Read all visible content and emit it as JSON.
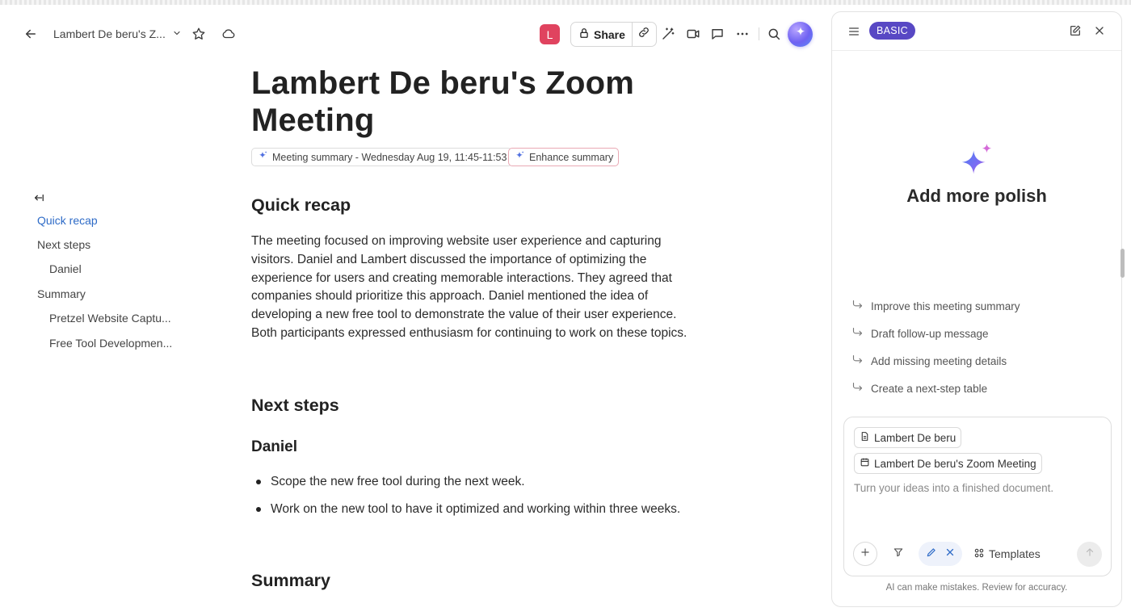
{
  "toolbar": {
    "breadcrumb": "Lambert De beru's Z...",
    "avatar_letter": "L",
    "share_label": "Share"
  },
  "outline": {
    "items": [
      {
        "label": "Quick recap",
        "level": 1,
        "active": true
      },
      {
        "label": "Next steps",
        "level": 1
      },
      {
        "label": "Daniel",
        "level": 2
      },
      {
        "label": "Summary",
        "level": 1
      },
      {
        "label": "Pretzel Website Captu...",
        "level": 2
      },
      {
        "label": "Free Tool Developmen...",
        "level": 2
      }
    ]
  },
  "document": {
    "title": "Lambert De beru's Zoom Meeting",
    "summary_chip": "Meeting summary - Wednesday Aug 19, 11:45-11:53",
    "enhance_chip": "Enhance summary",
    "quick_recap_heading": "Quick recap",
    "quick_recap_body": "The meeting focused on improving website user experience and capturing visitors. Daniel and Lambert discussed the importance of optimizing the experience for users and creating memorable interactions. They agreed that companies should prioritize this approach. Daniel mentioned the idea of developing a new free tool to demonstrate the value of their user experience. Both participants expressed enthusiasm for continuing to work on these topics.",
    "next_steps_heading": "Next steps",
    "daniel_heading": "Daniel",
    "daniel_items": [
      "Scope the new free tool during the next week.",
      "Work on the new tool to have it optimized and working within three weeks."
    ],
    "summary_heading": "Summary"
  },
  "ai_panel": {
    "badge": "BASIC",
    "title": "Add more polish",
    "suggestions": [
      "Improve this meeting summary",
      "Draft follow-up message",
      "Add missing meeting details",
      "Create a next-step table"
    ],
    "context_chips": [
      "Lambert De beru",
      "Lambert De beru's Zoom Meeting"
    ],
    "input_placeholder": "Turn your ideas into a finished document.",
    "templates_label": "Templates",
    "disclaimer": "AI can make mistakes. Review for accuracy."
  },
  "colors": {
    "accent": "#2e6bc7",
    "badge": "#5848c4",
    "avatar": "#e0435f"
  }
}
